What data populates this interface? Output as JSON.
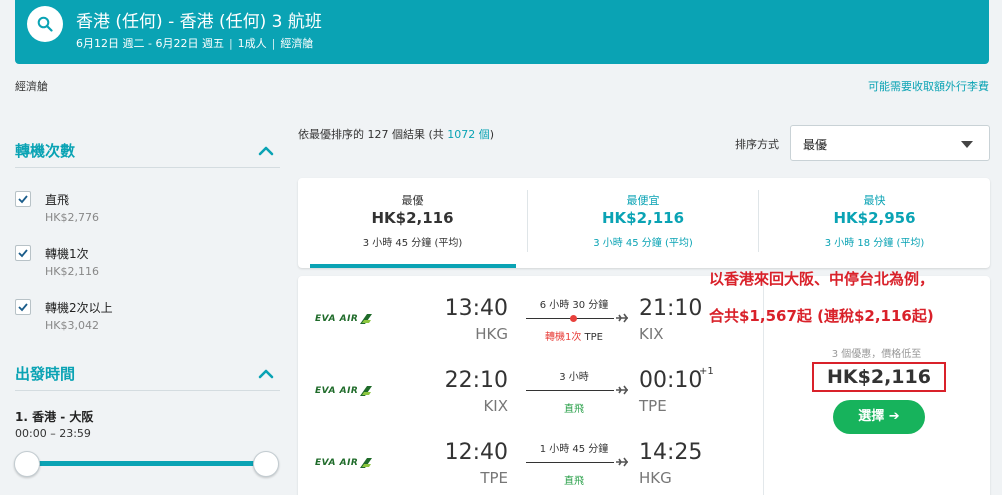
{
  "header": {
    "route": "香港 (任何) - 香港 (任何) 3 航班",
    "dates": "6月12日 週二 - 6月22日 週五",
    "passengers": "1成人",
    "cabin": "經濟艙"
  },
  "cabin_note": "經濟艙",
  "baggage_link": "可能需要收取額外行李費",
  "filters": {
    "stops": {
      "title": "轉機次數",
      "options": [
        {
          "label": "直飛",
          "price": "HK$2,776",
          "checked": true
        },
        {
          "label": "轉機1次",
          "price": "HK$2,116",
          "checked": true
        },
        {
          "label": "轉機2次以上",
          "price": "HK$3,042",
          "checked": true
        }
      ]
    },
    "departure": {
      "title": "出發時間",
      "leg_label": "1. 香港 - 大阪",
      "range": "00:00 – 23:59"
    }
  },
  "results": {
    "prefix": "依最優排序的 ",
    "shown": "127",
    "mid": " 個結果 (共 ",
    "total": "1072 個",
    "suffix": ")"
  },
  "sort": {
    "label": "排序方式",
    "value": "最優"
  },
  "tabs": [
    {
      "name": "最優",
      "price": "HK$2,116",
      "duration": "3 小時 45 分鐘 (平均)",
      "active": true
    },
    {
      "name": "最便宜",
      "price": "HK$2,116",
      "duration": "3 小時 45 分鐘 (平均)",
      "active": false
    },
    {
      "name": "最快",
      "price": "HK$2,956",
      "duration": "3 小時 18 分鐘 (平均)",
      "active": false
    }
  ],
  "result": {
    "airline": "EVA AIR",
    "legs": [
      {
        "dep_time": "13:40",
        "dep_code": "HKG",
        "arr_time": "21:10",
        "arr_code": "KIX",
        "duration": "6 小時 30 分鐘",
        "stop_count": "轉機1次",
        "stop_airport": " TPE",
        "direct": false,
        "plus_day": ""
      },
      {
        "dep_time": "22:10",
        "dep_code": "KIX",
        "arr_time": "00:10",
        "arr_code": "TPE",
        "duration": "3 小時",
        "stop_count": "直飛",
        "stop_airport": "",
        "direct": true,
        "plus_day": "+1"
      },
      {
        "dep_time": "12:40",
        "dep_code": "TPE",
        "arr_time": "14:25",
        "arr_code": "HKG",
        "duration": "1 小時 45 分鐘",
        "stop_count": "直飛",
        "stop_airport": "",
        "direct": true,
        "plus_day": ""
      }
    ],
    "deals": "3 個優惠，價格低至",
    "price": "HK$2,116",
    "select_label": "選擇 ➔"
  },
  "annotation": {
    "line1": "以香港來回大阪、中停台北為例，",
    "line2": "合共$1,567起 (連稅$2,116起)"
  },
  "colors": {
    "accent": "#0aa3b4",
    "select": "#17b35c",
    "highlight": "#d9212a",
    "eva_green": "#1f6b2a"
  }
}
